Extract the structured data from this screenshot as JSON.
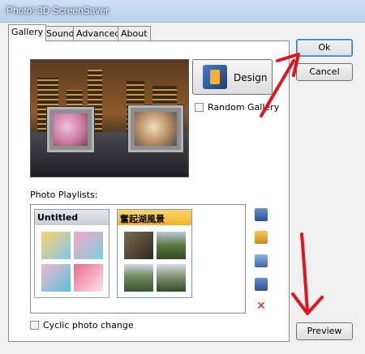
{
  "window": {
    "title": "Photo! 3D ScreenSaver"
  },
  "tabs": [
    "Gallery",
    "Sound",
    "Advanced",
    "About"
  ],
  "gallery": {
    "design_label": "Design",
    "random_gallery_label": "Random Gallery",
    "random_gallery_checked": false,
    "photo_playlists_label": "Photo Playlists:",
    "playlists": [
      {
        "name": "Untitled",
        "selected": false
      },
      {
        "name": "奮起湖風景",
        "selected": true
      }
    ],
    "cyclic_photo_change_label": "Cyclic photo change",
    "cyclic_photo_change_checked": false,
    "side_icons": [
      "add-playlist-icon",
      "open-folder-icon",
      "edit-playlist-icon",
      "playlist-settings-icon",
      "delete-icon"
    ]
  },
  "buttons": {
    "ok": "Ok",
    "cancel": "Cancel",
    "preview": "Preview"
  },
  "colors": {
    "selected_header": "#f5b935",
    "unselected_header": "#d4d8e0",
    "annotation_arrow": "#e0141e"
  }
}
